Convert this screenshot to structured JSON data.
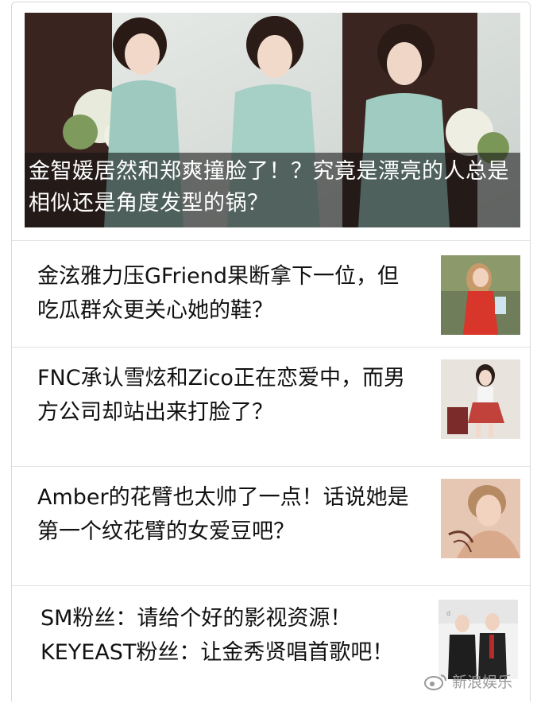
{
  "hero": {
    "title": "金智媛居然和郑爽撞脸了！？究竟是漂亮的人总是相似还是角度发型的锅？",
    "image_alt": "three-women-photo"
  },
  "articles": [
    {
      "title": "金泫雅力压GFriend果断拿下一位，但吃瓜群众更关心她的鞋？",
      "thumb": "woman-in-red-dress-photo"
    },
    {
      "title": "FNC承认雪炫和Zico正在恋爱中，而男方公司却站出来打脸了？",
      "thumb": "woman-in-red-skirt-photo"
    },
    {
      "title": "Amber的花臂也太帅了一点！话说她是第一个纹花臂的女爱豆吧？",
      "thumb": "portrait-photo"
    },
    {
      "title": "SM粉丝：请给个好的影视资源！KEYEAST粉丝：让金秀贤唱首歌吧！",
      "thumb": "two-men-in-suits-photo"
    }
  ],
  "watermark": {
    "text": "新浪娱乐",
    "icon": "weibo-icon"
  }
}
